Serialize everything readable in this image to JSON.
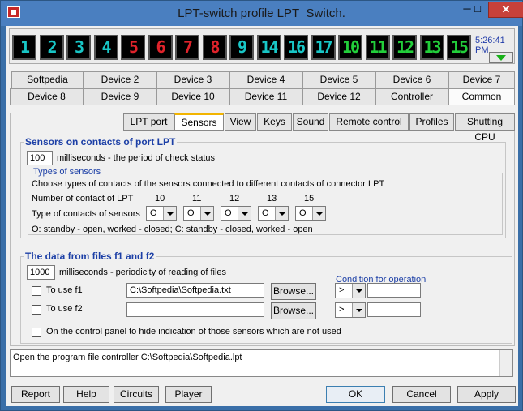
{
  "window": {
    "title": "LPT-switch profile LPT_Switch."
  },
  "leds": [
    {
      "label": "1",
      "color": "cyan"
    },
    {
      "label": "2",
      "color": "cyan"
    },
    {
      "label": "3",
      "color": "cyan"
    },
    {
      "label": "4",
      "color": "cyan"
    },
    {
      "label": "5",
      "color": "red"
    },
    {
      "label": "6",
      "color": "red"
    },
    {
      "label": "7",
      "color": "red"
    },
    {
      "label": "8",
      "color": "red"
    },
    {
      "label": "9",
      "color": "cyan"
    },
    {
      "label": "14",
      "color": "cyan"
    },
    {
      "label": "16",
      "color": "cyan"
    },
    {
      "label": "17",
      "color": "cyan"
    },
    {
      "label": "10",
      "color": "green"
    },
    {
      "label": "11",
      "color": "green"
    },
    {
      "label": "12",
      "color": "green"
    },
    {
      "label": "13",
      "color": "green"
    },
    {
      "label": "15",
      "color": "green"
    }
  ],
  "clock": "5:26:41 PM",
  "device_tabs_row1": [
    "Softpedia",
    "Device 2",
    "Device 3",
    "Device 4",
    "Device 5",
    "Device 6",
    "Device 7"
  ],
  "device_tabs_row2": [
    "Device 8",
    "Device 9",
    "Device 10",
    "Device 11",
    "Device 12",
    "Controller",
    "Common"
  ],
  "sub_tabs": [
    "LPT port",
    "Sensors",
    "View",
    "Keys",
    "Sound",
    "Remote control",
    "Profiles",
    "Shutting CPU"
  ],
  "sensors": {
    "title": "Sensors on contacts of port LPT",
    "period_value": "100",
    "period_label": "milliseconds - the period of check status",
    "types_title": "Types of sensors",
    "types_desc": "Choose types of contacts of the sensors connected to different contacts of connector LPT",
    "contact_label": "Number of contact of LPT",
    "contact_numbers": [
      "10",
      "11",
      "12",
      "13",
      "15"
    ],
    "type_label": "Type of contacts of sensors",
    "type_values": [
      "O",
      "O",
      "O",
      "O",
      "O"
    ],
    "legend": "O: standby - open, worked - closed; C: standby - closed, worked - open"
  },
  "files": {
    "title": "The data from files f1 and f2",
    "period_value": "1000",
    "period_label": "milliseconds - periodicity of reading of files",
    "condition_label": "Condition for operation",
    "f1_label": "To use f1",
    "f1_path": "C:\\Softpedia\\Softpedia.txt",
    "f2_label": "To use f2",
    "f2_path": "",
    "browse_label": "Browse...",
    "op1": ">",
    "op2": ">"
  },
  "hide_label": "On the control panel to hide indication of those sensors which are not used",
  "status_text": "Open the program file controller C:\\Softpedia\\Softpedia.lpt",
  "bottom": {
    "report": "Report",
    "help": "Help",
    "circuits": "Circuits",
    "player": "Player",
    "ok": "OK",
    "cancel": "Cancel",
    "apply": "Apply"
  },
  "titlebar": {
    "min": "─",
    "max": "□",
    "close": "✕"
  }
}
